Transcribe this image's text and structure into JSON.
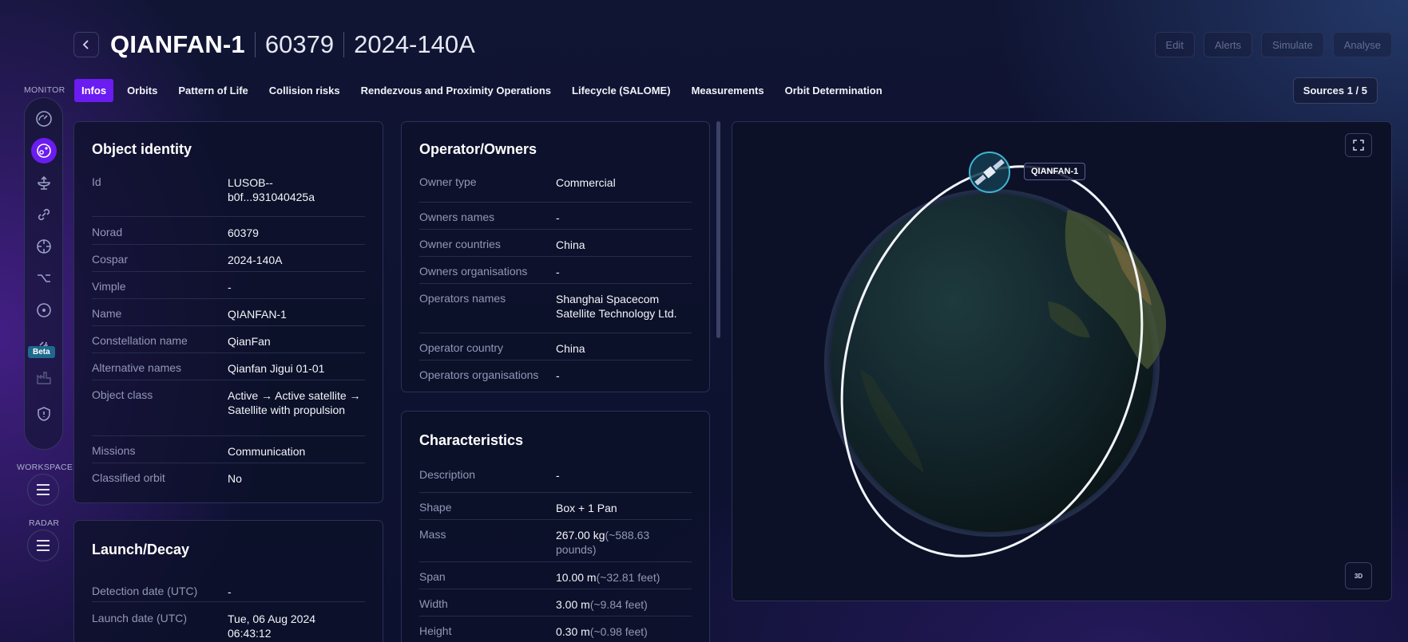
{
  "header": {
    "title": "QIANFAN-1",
    "norad": "60379",
    "cospar": "2024-140A",
    "actions": [
      "Edit",
      "Alerts",
      "Simulate",
      "Analyse"
    ]
  },
  "tabs": [
    "Infos",
    "Orbits",
    "Pattern of Life",
    "Collision risks",
    "Rendezvous and Proximity Operations",
    "Lifecycle (SALOME)",
    "Measurements",
    "Orbit Determination"
  ],
  "active_tab": "Infos",
  "sources_label": "Sources 1 / 5",
  "rail": {
    "monitor_label": "MONITOR",
    "workspace_label": "WORKSPACE",
    "radar_label": "RADAR",
    "beta_label": "Beta",
    "icons": [
      "dashboard-icon",
      "satellite-orbit-icon",
      "ground-station-icon",
      "link-icon",
      "crosshair-icon",
      "maneuver-icon",
      "target-icon",
      "satellite-signal-icon",
      "industry-icon",
      "shield-icon"
    ]
  },
  "object_identity": {
    "title": "Object identity",
    "rows": [
      {
        "key": "Id",
        "value": "LUSOB--b0f...931040425a"
      },
      {
        "key": "Norad",
        "value": "60379"
      },
      {
        "key": "Cospar",
        "value": "2024-140A"
      },
      {
        "key": "Vimple",
        "value": "-"
      },
      {
        "key": "Name",
        "value": "QIANFAN-1"
      },
      {
        "key": "Constellation name",
        "value": "QianFan"
      },
      {
        "key": "Alternative names",
        "value": "Qianfan Jigui 01-01"
      },
      {
        "key": "Object class",
        "value": "Active → Active satellite → Satellite with propulsion"
      },
      {
        "key": "Missions",
        "value": "Communication"
      },
      {
        "key": "Classified orbit",
        "value": "No"
      }
    ]
  },
  "launch_decay": {
    "title": "Launch/Decay",
    "rows": [
      {
        "key": "Detection date (UTC)",
        "value": "-"
      },
      {
        "key": "Launch date (UTC)",
        "value": "Tue, 06 Aug 2024 06:43:12"
      }
    ]
  },
  "operator_owners": {
    "title": "Operator/Owners",
    "rows": [
      {
        "key": "Owner type",
        "value": "Commercial"
      },
      {
        "key": "Owners names",
        "value": "-"
      },
      {
        "key": "Owner countries",
        "value": "China"
      },
      {
        "key": "Owners organisations",
        "value": "-"
      },
      {
        "key": "Operators names",
        "value": "Shanghai Spacecom Satellite Technology Ltd."
      },
      {
        "key": "Operator country",
        "value": "China"
      },
      {
        "key": "Operators organisations",
        "value": "-"
      }
    ]
  },
  "characteristics": {
    "title": "Characteristics",
    "rows": [
      {
        "key": "Description",
        "value": "-",
        "extra": ""
      },
      {
        "key": "Shape",
        "value": "Box + 1 Pan",
        "extra": ""
      },
      {
        "key": "Mass",
        "value": "267.00 kg",
        "extra": "(~588.63 pounds)"
      },
      {
        "key": "Span",
        "value": "10.00 m",
        "extra": "(~32.81 feet)"
      },
      {
        "key": "Width",
        "value": "3.00 m",
        "extra": "(~9.84 feet)"
      },
      {
        "key": "Height",
        "value": "0.30 m",
        "extra": "(~0.98 feet)"
      }
    ]
  },
  "map": {
    "satellite_label": "QIANFAN-1",
    "view_toggle": "3D"
  }
}
